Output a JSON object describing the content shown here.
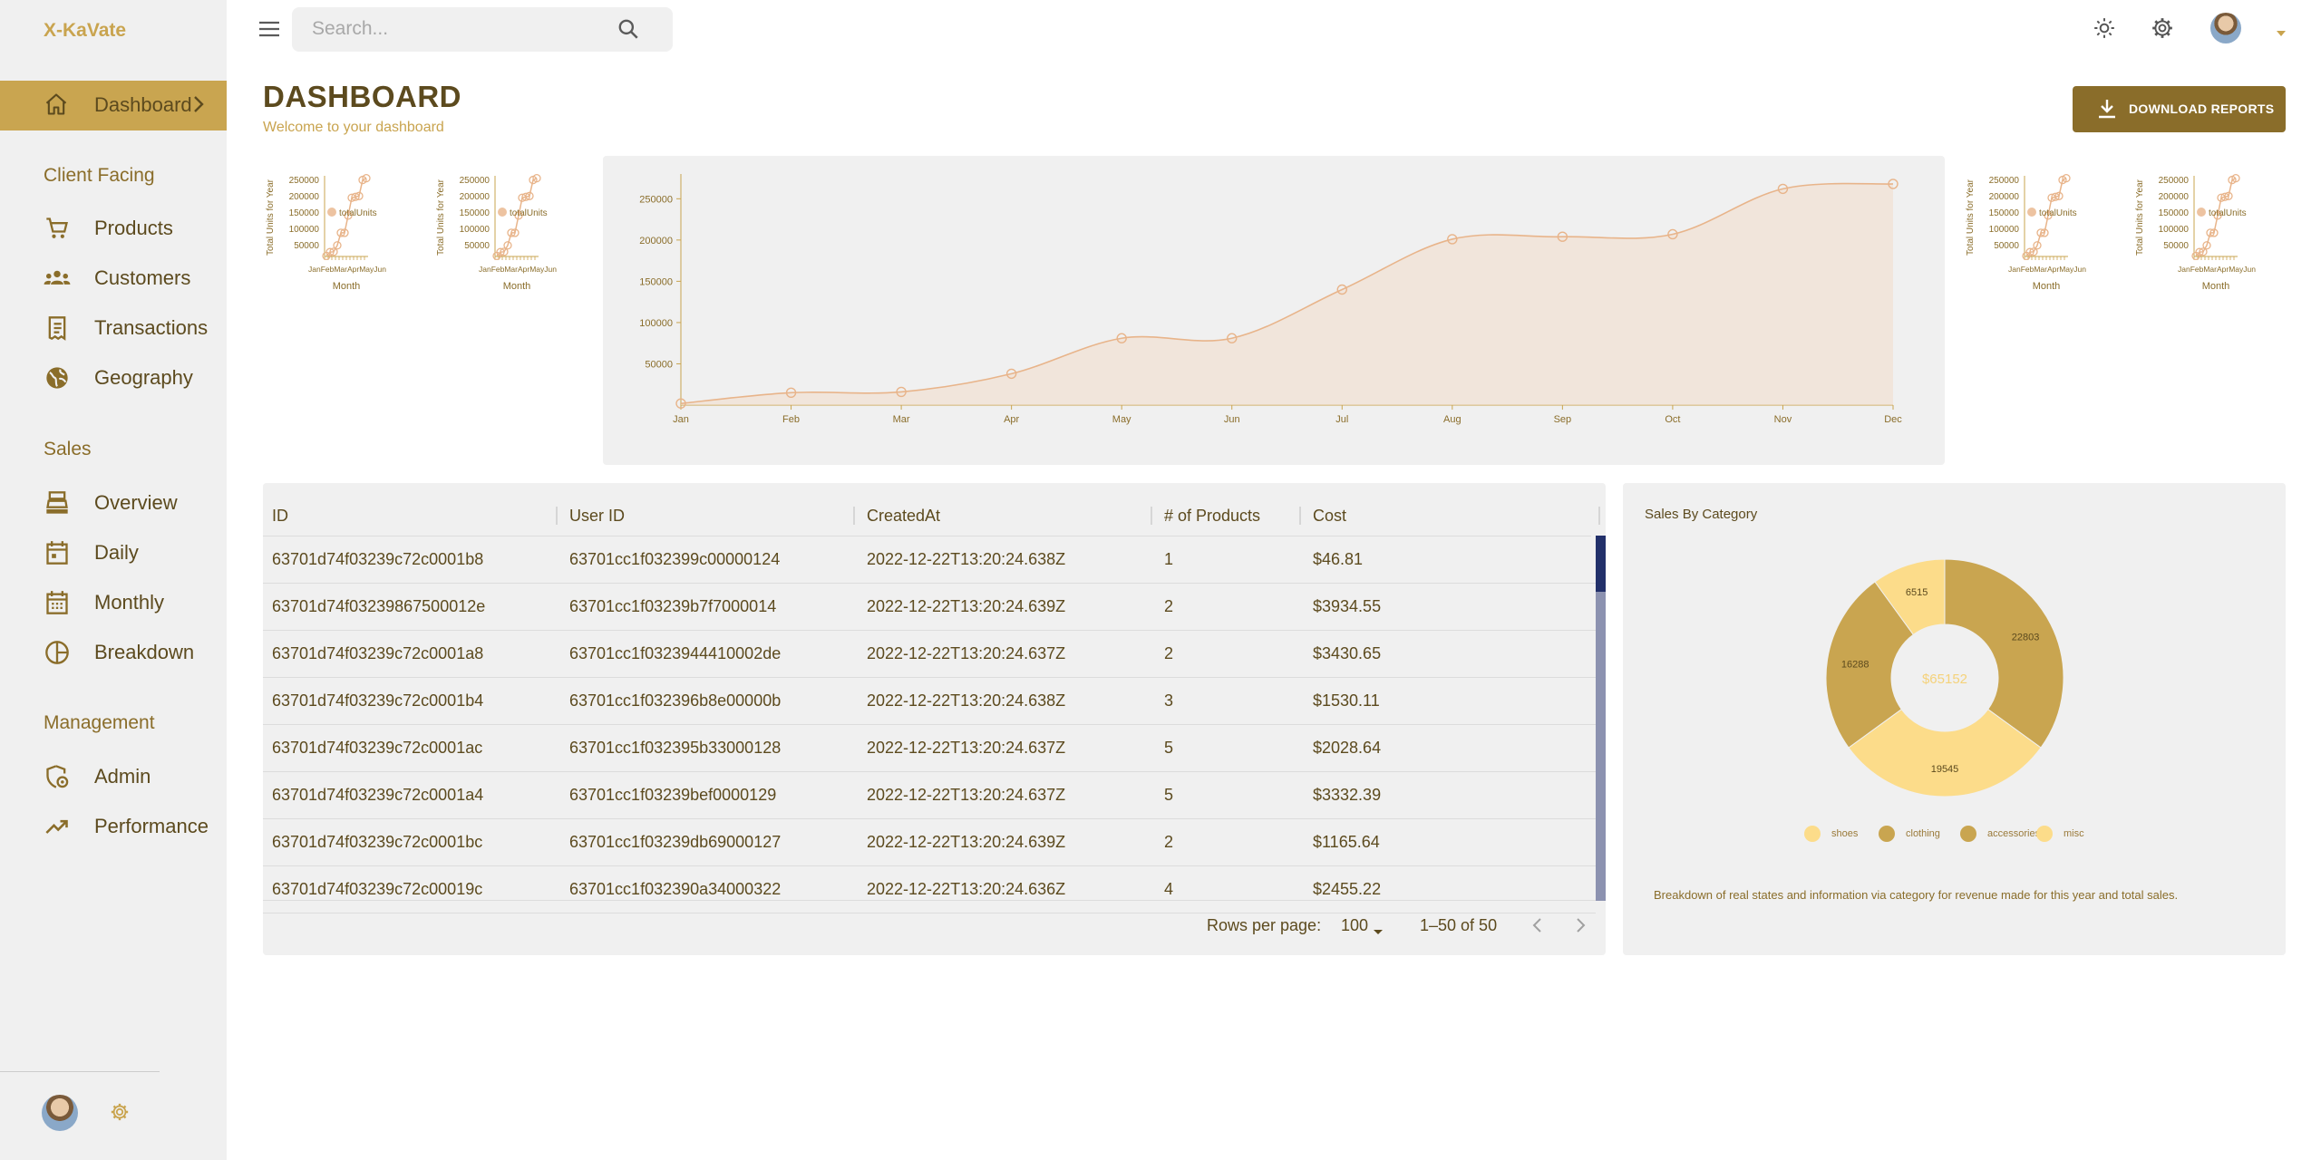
{
  "app": {
    "brand": "X-KaVate"
  },
  "nav": {
    "active": {
      "label": "Dashboard"
    },
    "sections": [
      {
        "title": "Client Facing",
        "items": [
          {
            "label": "Products",
            "icon": "cart-icon"
          },
          {
            "label": "Customers",
            "icon": "groups-icon"
          },
          {
            "label": "Transactions",
            "icon": "receipt-icon"
          },
          {
            "label": "Geography",
            "icon": "globe-icon"
          }
        ]
      },
      {
        "title": "Sales",
        "items": [
          {
            "label": "Overview",
            "icon": "point-of-sale-icon"
          },
          {
            "label": "Daily",
            "icon": "calendar-day-icon"
          },
          {
            "label": "Monthly",
            "icon": "calendar-month-icon"
          },
          {
            "label": "Breakdown",
            "icon": "pie-chart-icon"
          }
        ]
      },
      {
        "title": "Management",
        "items": [
          {
            "label": "Admin",
            "icon": "admin-icon"
          },
          {
            "label": "Performance",
            "icon": "trending-up-icon"
          }
        ]
      }
    ]
  },
  "topbar": {
    "search_placeholder": "Search..."
  },
  "header": {
    "title": "DASHBOARD",
    "subtitle": "Welcome to your dashboard",
    "download_label": "DOWNLOAD REPORTS"
  },
  "mini_chart": {
    "ylabel": "Total Units for Year",
    "xlabel": "Month",
    "legend": "totalUnits",
    "ticks": [
      "250000",
      "200000",
      "150000",
      "100000",
      "50000"
    ]
  },
  "chart_data": [
    {
      "type": "area",
      "x": [
        "Jan",
        "Feb",
        "Mar",
        "Apr",
        "May",
        "Jun",
        "Jul",
        "Aug",
        "Sep",
        "Oct",
        "Nov",
        "Dec"
      ],
      "values": [
        2000,
        15000,
        16000,
        38000,
        81000,
        81000,
        140000,
        201000,
        204000,
        207000,
        262000,
        268000
      ],
      "ylim": [
        0,
        280000
      ],
      "yticks": [
        50000,
        100000,
        150000,
        200000,
        250000
      ],
      "color": "#e8b48a"
    },
    {
      "type": "pie",
      "title": "Sales By Category",
      "center_label": "$65152",
      "slices": [
        {
          "name": "clothing",
          "value": 22803,
          "color": "#c9a550"
        },
        {
          "name": "shoes",
          "value": 19545,
          "color": "#fcdc8a"
        },
        {
          "name": "accessories",
          "value": 16288,
          "color": "#c9a550"
        },
        {
          "name": "misc",
          "value": 6515,
          "color": "#fcdc8a"
        }
      ],
      "legend": [
        {
          "name": "shoes",
          "color": "#fcdc8a"
        },
        {
          "name": "clothing",
          "color": "#c9a550"
        },
        {
          "name": "accessories",
          "color": "#c9a550"
        },
        {
          "name": "misc",
          "color": "#fcdc8a"
        }
      ],
      "description": "Breakdown of real states and information via category for revenue made for this year and total sales."
    }
  ],
  "table": {
    "columns": [
      "ID",
      "User ID",
      "CreatedAt",
      "# of Products",
      "Cost"
    ],
    "rows": [
      [
        "63701d74f03239c72c0001b8",
        "63701cc1f032399c00000124",
        "2022-12-22T13:20:24.638Z",
        "1",
        "$46.81"
      ],
      [
        "63701d74f03239867500012e",
        "63701cc1f03239b7f7000014",
        "2022-12-22T13:20:24.639Z",
        "2",
        "$3934.55"
      ],
      [
        "63701d74f03239c72c0001a8",
        "63701cc1f0323944410002de",
        "2022-12-22T13:20:24.637Z",
        "2",
        "$3430.65"
      ],
      [
        "63701d74f03239c72c0001b4",
        "63701cc1f032396b8e00000b",
        "2022-12-22T13:20:24.638Z",
        "3",
        "$1530.11"
      ],
      [
        "63701d74f03239c72c0001ac",
        "63701cc1f032395b33000128",
        "2022-12-22T13:20:24.637Z",
        "5",
        "$2028.64"
      ],
      [
        "63701d74f03239c72c0001a4",
        "63701cc1f03239bef0000129",
        "2022-12-22T13:20:24.637Z",
        "5",
        "$3332.39"
      ],
      [
        "63701d74f03239c72c0001bc",
        "63701cc1f03239db69000127",
        "2022-12-22T13:20:24.639Z",
        "2",
        "$1165.64"
      ],
      [
        "63701d74f03239c72c00019c",
        "63701cc1f032390a34000322",
        "2022-12-22T13:20:24.636Z",
        "4",
        "$2455.22"
      ]
    ],
    "rows_per_page_label": "Rows per page:",
    "rows_per_page": "100",
    "page_info": "1–50 of 50"
  }
}
